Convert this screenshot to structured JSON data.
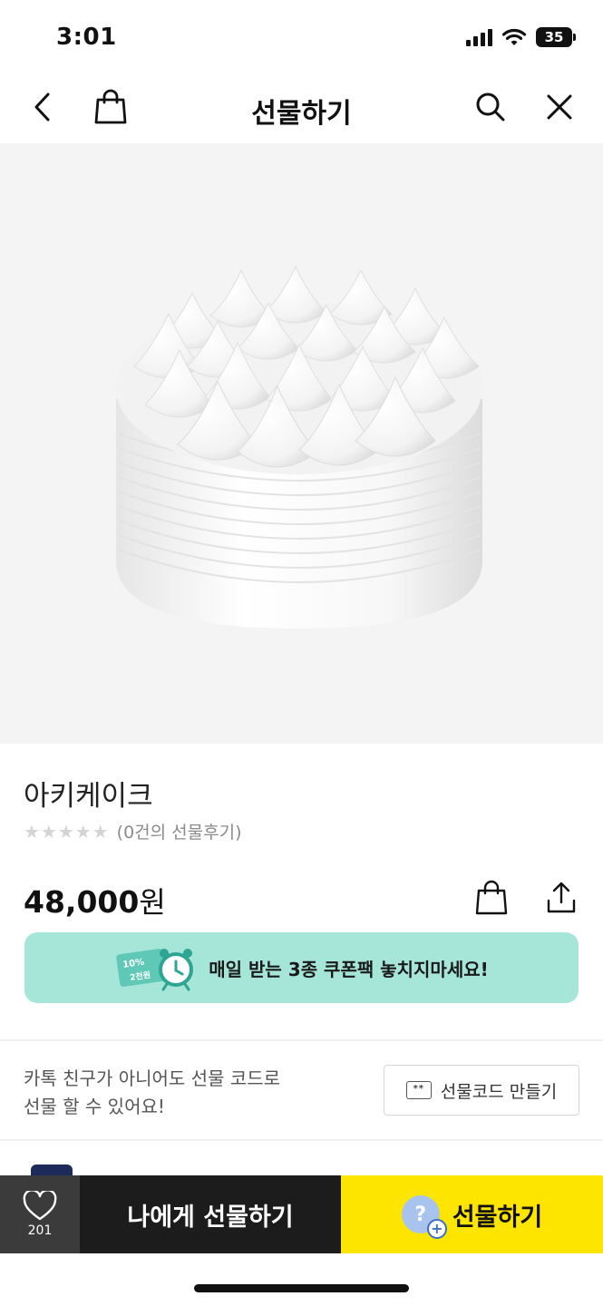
{
  "status_bar": {
    "time": "3:01",
    "battery": "35",
    "icons": [
      "signal-icon",
      "wifi-icon",
      "battery-icon"
    ]
  },
  "header": {
    "title": "선물하기",
    "icons": [
      "back-icon",
      "shopping-bag-icon",
      "search-icon",
      "close-icon"
    ]
  },
  "product": {
    "name": "아키케이크",
    "rating_value": 0,
    "rating_max": 5,
    "review_count_text": "(0건의 선물후기)",
    "price": "48,000",
    "price_unit": "원"
  },
  "coupon_banner": {
    "badge_top": "10%",
    "badge_bottom": "2천원",
    "text": "매일 받는 3종 쿠폰팩 놓치지마세요!"
  },
  "gift_code": {
    "description_line1": "카톡 친구가 아니어도 선물 코드로",
    "description_line2": "선물 할 수 있어요!",
    "icon_text": "**",
    "button_label": "선물코드 만들기"
  },
  "bottom_bar": {
    "wish_count": "201",
    "self_gift_label": "나에게 선물하기",
    "gift_label": "선물하기",
    "gift_icon_text": "?",
    "colors": {
      "gift": "#fee500",
      "self_gift": "#1c1c1c",
      "wish": "#3b3b3b"
    }
  },
  "colors": {
    "coupon_banner": "#a5e6d9",
    "image_bg": "#f4f4f4"
  }
}
